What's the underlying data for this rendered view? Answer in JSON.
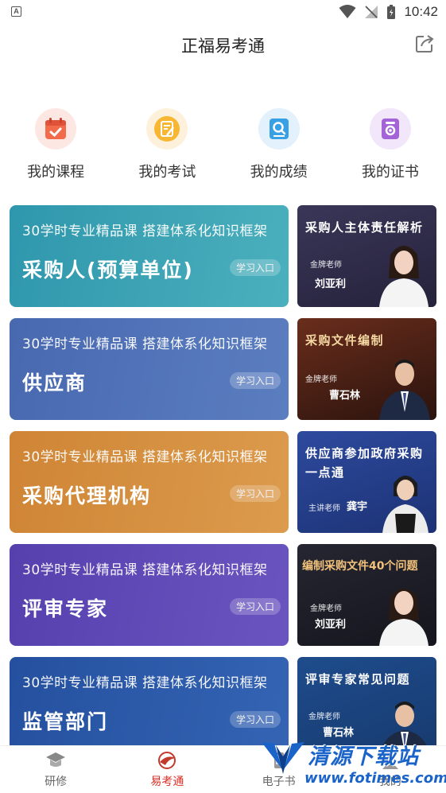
{
  "status_bar": {
    "notification_letter": "A",
    "time": "10:42"
  },
  "header": {
    "title": "正福易考通"
  },
  "quick_menu": [
    {
      "label": "我的课程",
      "icon": "calendar-icon",
      "color": "#f26b4b",
      "bg": "#fde7e3"
    },
    {
      "label": "我的考试",
      "icon": "exam-icon",
      "color": "#f5a623",
      "bg": "#fdf1dc"
    },
    {
      "label": "我的成绩",
      "icon": "scores-icon",
      "color": "#3aa0e6",
      "bg": "#e2f1fc"
    },
    {
      "label": "我的证书",
      "icon": "certificate-icon",
      "color": "#a463d6",
      "bg": "#f1e6fa"
    }
  ],
  "courses": [
    {
      "subtitle": "30学时专业精品课   搭建体系化知识框架",
      "name": "采购人(预算单位)",
      "entry": "学习入口",
      "color": "#3a9fb2"
    },
    {
      "subtitle": "30学时专业精品课   搭建体系化知识框架",
      "name": "供应商",
      "entry": "学习入口",
      "color": "#4d6fb5"
    },
    {
      "subtitle": "30学时专业精品课   搭建体系化知识框架",
      "name": "采购代理机构",
      "entry": "学习入口",
      "color": "#d28a3c"
    },
    {
      "subtitle": "30学时专业精品课   搭建体系化知识框架",
      "name": "评审专家",
      "entry": "学习入口",
      "color": "#5a45b4"
    },
    {
      "subtitle": "30学时专业精品课   搭建体系化知识框架",
      "name": "监管部门",
      "entry": "学习入口",
      "color": "#2d5aa5"
    }
  ],
  "promos": [
    {
      "title": "采购人主体责任解析",
      "rank": "金牌老师",
      "teacher": "刘亚利"
    },
    {
      "title": "采购文件编制",
      "rank": "金牌老师",
      "teacher": "曹石林"
    },
    {
      "title": "供应商参加政府采购一点通",
      "rank": "主讲老师",
      "teacher": "龚宇"
    },
    {
      "title": "编制采购文件40个问题",
      "rank": "金牌老师",
      "teacher": "刘亚利"
    },
    {
      "title": "评审专家常见问题",
      "rank": "金牌老师",
      "teacher": "曹石林"
    }
  ],
  "bottom_nav": [
    {
      "label": "研修",
      "icon": "graduation-cap-icon"
    },
    {
      "label": "易考通",
      "icon": "exam-logo-icon",
      "active": true
    },
    {
      "label": "电子书",
      "icon": "ebook-icon"
    },
    {
      "label": "我的",
      "icon": "profile-icon"
    }
  ],
  "watermark": {
    "text": "清源下载站",
    "url": "www.fotimes.com"
  }
}
